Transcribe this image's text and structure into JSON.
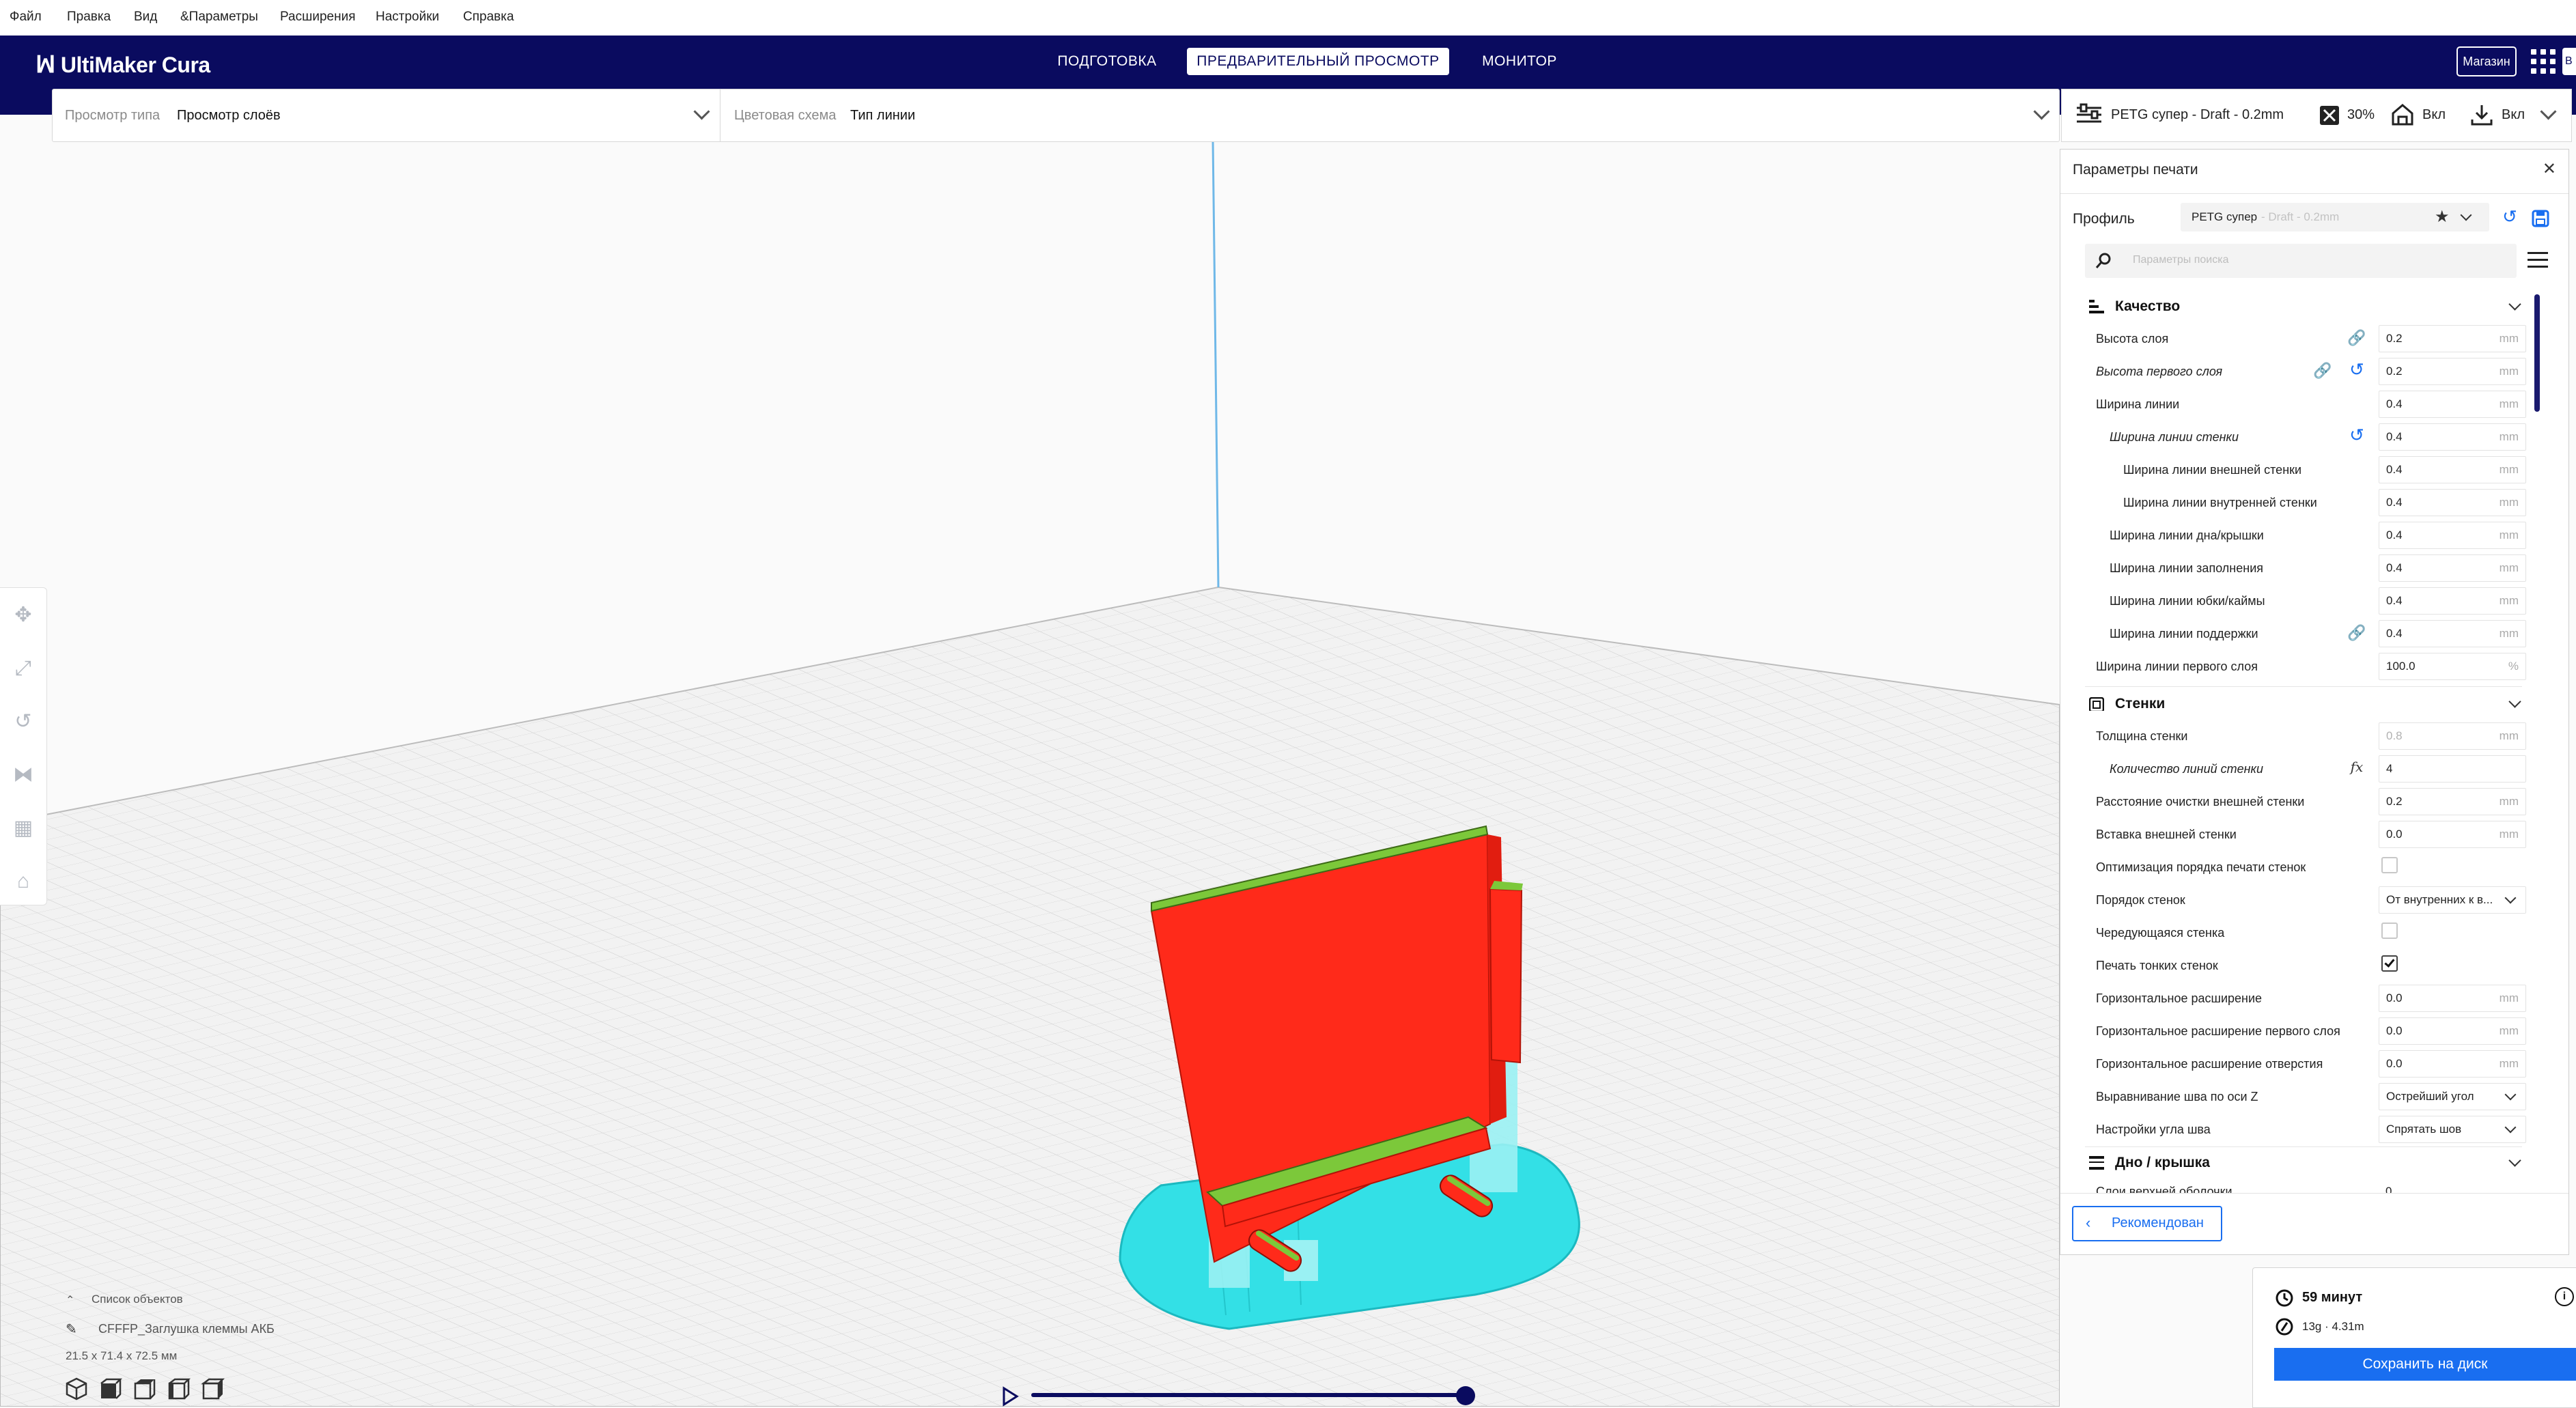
{
  "window": {
    "title": "CFFFP_Заглушка клеммы АКБ - UltiMaker Cura",
    "menu": [
      "Файл",
      "Правка",
      "Вид",
      "&Параметры",
      "Расширения",
      "Настройки",
      "Справка"
    ]
  },
  "header": {
    "logo": "UltiMaker Cura",
    "stages": [
      "ПОДГОТОВКА",
      "ПРЕДВАРИТЕЛЬНЫЙ ПРОСМОТР",
      "МОНИТОР"
    ],
    "active_stage": "ПРЕДВАРИТЕЛЬНЫЙ ПРОСМОТР",
    "marketplace": "Магазин",
    "account_initial": "B"
  },
  "viewbar": {
    "view_type_label": "Просмотр типа",
    "view_type_value": "Просмотр слоёв",
    "color_scheme_label": "Цветовая схема",
    "color_scheme_value": "Тип линии"
  },
  "print_setup": {
    "profile_summary": "PETG супер - Draft - 0.2mm",
    "infill": "30%",
    "support": "Вкл",
    "adhesion": "Вкл"
  },
  "panel": {
    "title": "Параметры печати",
    "profile_label": "Профиль",
    "profile_name": "PETG супер",
    "profile_suffix": "- Draft - 0.2mm",
    "search_placeholder": "Параметры поиска",
    "recommended_button": "Рекомендован",
    "categories": {
      "quality": "Качество",
      "walls": "Стенки",
      "topbottom": "Дно / крышка"
    },
    "quality_rows": [
      {
        "label": "Высота слоя",
        "value": "0.2",
        "unit": "mm"
      },
      {
        "label": "Высота первого слоя",
        "value": "0.2",
        "unit": "mm"
      },
      {
        "label": "Ширина линии",
        "value": "0.4",
        "unit": "mm"
      },
      {
        "label": "Ширина линии стенки",
        "value": "0.4",
        "unit": "mm"
      },
      {
        "label": "Ширина линии внешней стенки",
        "value": "0.4",
        "unit": "mm"
      },
      {
        "label": "Ширина линии внутренней стенки",
        "value": "0.4",
        "unit": "mm"
      },
      {
        "label": "Ширина линии дна/крышки",
        "value": "0.4",
        "unit": "mm"
      },
      {
        "label": "Ширина линии заполнения",
        "value": "0.4",
        "unit": "mm"
      },
      {
        "label": "Ширина линии юбки/каймы",
        "value": "0.4",
        "unit": "mm"
      },
      {
        "label": "Ширина линии поддержки",
        "value": "0.4",
        "unit": "mm"
      },
      {
        "label": "Ширина линии первого слоя",
        "value": "100.0",
        "unit": "%"
      }
    ],
    "wall_rows": [
      {
        "label": "Толщина стенки",
        "value": "0.8",
        "unit": "mm"
      },
      {
        "label": "Количество линий стенки",
        "value": "4",
        "unit": ""
      },
      {
        "label": "Расстояние очистки внешней стенки",
        "value": "0.2",
        "unit": "mm"
      },
      {
        "label": "Вставка внешней стенки",
        "value": "0.0",
        "unit": "mm"
      },
      {
        "label": "Оптимизация порядка печати стенок",
        "checked": false
      },
      {
        "label": "Порядок стенок",
        "value": "От внутренних к в..."
      },
      {
        "label": "Чередующаяся стенка",
        "checked": false
      },
      {
        "label": "Печать тонких стенок",
        "checked": true
      },
      {
        "label": "Горизонтальное расширение",
        "value": "0.0",
        "unit": "mm"
      },
      {
        "label": "Горизонтальное расширение первого слоя",
        "value": "0.0",
        "unit": "mm"
      },
      {
        "label": "Горизонтальное расширение отверстия",
        "value": "0.0",
        "unit": "mm"
      },
      {
        "label": "Выравнивание шва по оси Z",
        "value": "Острейший угол"
      },
      {
        "label": "Настройки угла шва",
        "value": "Спрятать шов"
      }
    ],
    "topbottom_partial_label": "Слои верхней оболочки",
    "topbottom_partial_value": "0"
  },
  "objects": {
    "list_label": "Список объектов",
    "object_name": "CFFFP_Заглушка клеммы АКБ",
    "dimensions": "21.5 x 71.4 x 72.5 мм"
  },
  "job": {
    "time": "59 минут",
    "material": "13g · 4.31m",
    "save_button": "Сохранить на диск"
  },
  "colors": {
    "header_bg": "#0a0b5f",
    "accent": "#196ef0",
    "model_wall": "#ff2a1a",
    "model_top": "#7cc83a",
    "model_support": "#33e0e6"
  }
}
